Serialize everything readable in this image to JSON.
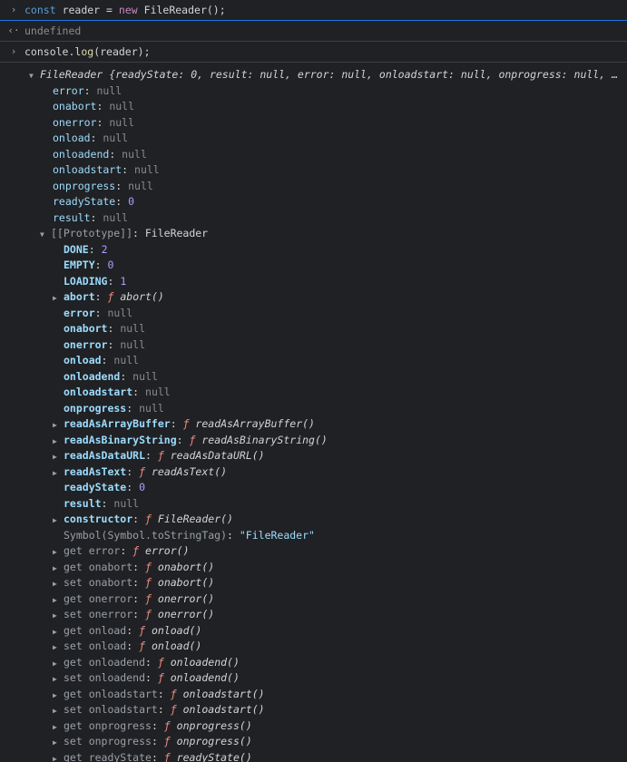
{
  "console": {
    "entries": {
      "input1": {
        "prompt_icon": "›",
        "t1": "const",
        "t2": "reader",
        "t3": "=",
        "t4": "new",
        "t5": "FileReader();"
      },
      "result1": {
        "icon": "‹·",
        "text": "undefined"
      },
      "input2": {
        "prompt_icon": "›",
        "t1": "console",
        "t2": ".",
        "t3": "log",
        "t4": "(reader);"
      }
    },
    "object_header": {
      "arrow": "▼",
      "name": "FileReader",
      "summary": "{readyState: 0, result: null, error: null, onloadstart: null, onprogress: null, …"
    },
    "own_props": [
      {
        "key": "error",
        "value": "null"
      },
      {
        "key": "onabort",
        "value": "null"
      },
      {
        "key": "onerror",
        "value": "null"
      },
      {
        "key": "onload",
        "value": "null"
      },
      {
        "key": "onloadend",
        "value": "null"
      },
      {
        "key": "onloadstart",
        "value": "null"
      },
      {
        "key": "onprogress",
        "value": "null"
      },
      {
        "key": "readyState",
        "value": "0"
      },
      {
        "key": "result",
        "value": "null"
      }
    ],
    "prototype": {
      "arrow": "▼",
      "label": "[[Prototype]]",
      "value": "FileReader",
      "items": [
        {
          "key": "DONE",
          "value": "2",
          "kind": "num"
        },
        {
          "key": "EMPTY",
          "value": "0",
          "kind": "num"
        },
        {
          "key": "LOADING",
          "value": "1",
          "kind": "num"
        },
        {
          "key": "abort",
          "value": "abort()",
          "kind": "fn",
          "expandable": true
        },
        {
          "key": "error",
          "value": "null",
          "kind": "null"
        },
        {
          "key": "onabort",
          "value": "null",
          "kind": "null"
        },
        {
          "key": "onerror",
          "value": "null",
          "kind": "null"
        },
        {
          "key": "onload",
          "value": "null",
          "kind": "null"
        },
        {
          "key": "onloadend",
          "value": "null",
          "kind": "null"
        },
        {
          "key": "onloadstart",
          "value": "null",
          "kind": "null"
        },
        {
          "key": "onprogress",
          "value": "null",
          "kind": "null"
        },
        {
          "key": "readAsArrayBuffer",
          "value": "readAsArrayBuffer()",
          "kind": "fn",
          "expandable": true
        },
        {
          "key": "readAsBinaryString",
          "value": "readAsBinaryString()",
          "kind": "fn",
          "expandable": true
        },
        {
          "key": "readAsDataURL",
          "value": "readAsDataURL()",
          "kind": "fn",
          "expandable": true
        },
        {
          "key": "readAsText",
          "value": "readAsText()",
          "kind": "fn",
          "expandable": true
        },
        {
          "key": "readyState",
          "value": "0",
          "kind": "num"
        },
        {
          "key": "result",
          "value": "null",
          "kind": "null"
        },
        {
          "key": "constructor",
          "value": "FileReader()",
          "kind": "fn",
          "expandable": true
        },
        {
          "key": "Symbol(Symbol.toStringTag)",
          "value": "\"FileReader\"",
          "kind": "str"
        },
        {
          "key": "get error",
          "value": "error()",
          "kind": "fn",
          "expandable": true,
          "accessor": true
        },
        {
          "key": "get onabort",
          "value": "onabort()",
          "kind": "fn",
          "expandable": true,
          "accessor": true
        },
        {
          "key": "set onabort",
          "value": "onabort()",
          "kind": "fn",
          "expandable": true,
          "accessor": true
        },
        {
          "key": "get onerror",
          "value": "onerror()",
          "kind": "fn",
          "expandable": true,
          "accessor": true
        },
        {
          "key": "set onerror",
          "value": "onerror()",
          "kind": "fn",
          "expandable": true,
          "accessor": true
        },
        {
          "key": "get onload",
          "value": "onload()",
          "kind": "fn",
          "expandable": true,
          "accessor": true
        },
        {
          "key": "set onload",
          "value": "onload()",
          "kind": "fn",
          "expandable": true,
          "accessor": true
        },
        {
          "key": "get onloadend",
          "value": "onloadend()",
          "kind": "fn",
          "expandable": true,
          "accessor": true
        },
        {
          "key": "set onloadend",
          "value": "onloadend()",
          "kind": "fn",
          "expandable": true,
          "accessor": true
        },
        {
          "key": "get onloadstart",
          "value": "onloadstart()",
          "kind": "fn",
          "expandable": true,
          "accessor": true
        },
        {
          "key": "set onloadstart",
          "value": "onloadstart()",
          "kind": "fn",
          "expandable": true,
          "accessor": true
        },
        {
          "key": "get onprogress",
          "value": "onprogress()",
          "kind": "fn",
          "expandable": true,
          "accessor": true
        },
        {
          "key": "set onprogress",
          "value": "onprogress()",
          "kind": "fn",
          "expandable": true,
          "accessor": true
        },
        {
          "key": "get readyState",
          "value": "readyState()",
          "kind": "fn",
          "expandable": true,
          "accessor": true
        }
      ]
    },
    "func_marker": "ƒ",
    "expand_arrow": "▶",
    "colors": {
      "background": "#202124",
      "key": "#9cdcfe",
      "null": "#8b8b8b",
      "number": "#a8a0ff",
      "function_marker": "#f28b82",
      "focus_border": "#1a73e8"
    }
  }
}
